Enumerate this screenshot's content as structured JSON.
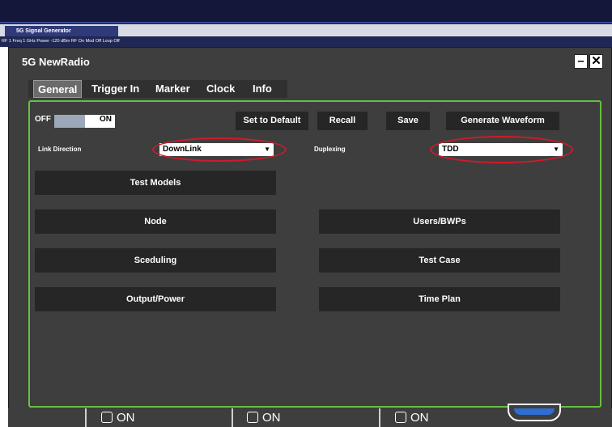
{
  "app": {
    "instrument_tab": "5G Signal Generator",
    "status_line": "RF 1 Freq 1 GHz Power -120 dBm  RF On  Mod Off  Loop Off"
  },
  "window": {
    "title": "5G NewRadio",
    "minimize": "–",
    "close": "✕"
  },
  "tabs": [
    {
      "label": "General",
      "active": true
    },
    {
      "label": "Trigger In",
      "active": false
    },
    {
      "label": "Marker",
      "active": false
    },
    {
      "label": "Clock",
      "active": false
    },
    {
      "label": "Info",
      "active": false
    }
  ],
  "toolbar": {
    "off_label": "OFF",
    "on_label": "ON",
    "set_default": "Set to Default",
    "recall": "Recall",
    "save": "Save",
    "generate": "Generate Waveform"
  },
  "settings": {
    "link_direction_label": "Link Direction",
    "link_direction_value": "DownLink",
    "duplexing_label": "Duplexing",
    "duplexing_value": "TDD",
    "highlight_color": "#d11a2a"
  },
  "menu_buttons": {
    "test_models": "Test Models",
    "node": "Node",
    "scheduling": "Sceduling",
    "output_power": "Output/Power",
    "users_bwps": "Users/BWPs",
    "test_case": "Test Case",
    "time_plan": "Time Plan"
  },
  "bottom": {
    "on1": "ON",
    "on2": "ON",
    "on3": "ON"
  },
  "colors": {
    "panel_border": "#63c23f",
    "accent_blue": "#2f6ed0",
    "window_bg": "#3e3e3e"
  }
}
